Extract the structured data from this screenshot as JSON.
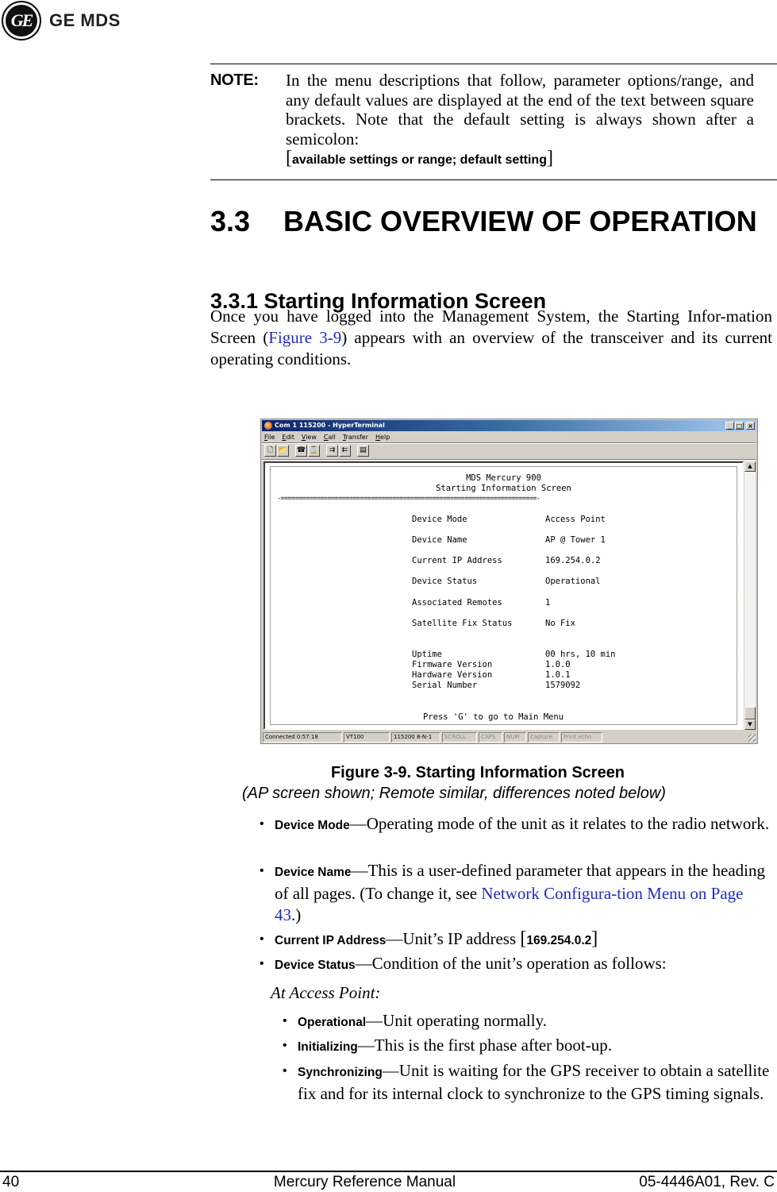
{
  "logo": {
    "monogram": "GE",
    "brand": "GE MDS"
  },
  "note": {
    "label": "NOTE:",
    "text": "In the menu descriptions that follow, parameter options/range, and any default values are displayed at the end of the text between square brackets. Note that the default setting is always shown after a semicolon:",
    "bracket_open": "[",
    "bracket_text": "available settings or range; default setting",
    "bracket_close": "]"
  },
  "section": {
    "number": "3.3",
    "title": "BASIC OVERVIEW OF OPERATION"
  },
  "subsection": {
    "title": "3.3.1 Starting Information Screen"
  },
  "intro": {
    "before": "Once you have logged into the Management System, the Starting Infor-mation Screen (",
    "link": "Figure 3-9",
    "after": ") appears with an overview of the transceiver and its current operating conditions."
  },
  "window": {
    "title": "Com 1 115200 - HyperTerminal",
    "controls": {
      "minimize": "_",
      "maximize": "□",
      "close": "×"
    },
    "menu": [
      "File",
      "Edit",
      "View",
      "Call",
      "Transfer",
      "Help"
    ],
    "toolbar": [
      {
        "name": "new-icon",
        "glyph": "🗋"
      },
      {
        "name": "open-icon",
        "glyph": "📂"
      },
      {
        "name": "connect-phone-icon",
        "glyph": "☎"
      },
      {
        "name": "disconnect-icon",
        "glyph": "⌛"
      },
      {
        "name": "send-icon",
        "glyph": "⇉"
      },
      {
        "name": "receive-icon",
        "glyph": "⇇"
      },
      {
        "name": "properties-icon",
        "glyph": "▤"
      }
    ],
    "terminal": {
      "header1": "MDS Mercury 900",
      "header2": "Starting Information Screen",
      "divider": "-=======================================================================-",
      "fields": [
        {
          "label": "Device Mode",
          "value": "Access Point"
        },
        {
          "label": "Device Name",
          "value": "AP @ Tower 1"
        },
        {
          "label": "Current IP Address",
          "value": "169.254.0.2"
        },
        {
          "label": "Device Status",
          "value": "Operational"
        },
        {
          "label": "Associated Remotes",
          "value": "1"
        },
        {
          "label": "Satellite Fix Status",
          "value": "No Fix"
        }
      ],
      "info": [
        {
          "label": "Uptime",
          "value": "00 hrs, 10 min"
        },
        {
          "label": "Firmware Version",
          "value": "1.0.0"
        },
        {
          "label": "Hardware Version",
          "value": "1.0.1"
        },
        {
          "label": "Serial Number",
          "value": "1579092"
        }
      ],
      "prompt": "Press 'G' to go to Main Menu"
    },
    "scroll": {
      "up": "▲",
      "down": "▼"
    },
    "status": {
      "connected": "Connected 0:57:18",
      "emulation": "VT100",
      "settings": "115200 8-N-1",
      "scroll": "SCROLL",
      "caps": "CAPS",
      "num": "NUM",
      "capture": "Capture",
      "print_echo": "Print echo"
    }
  },
  "figure": {
    "title": "Figure 3-9. Starting Information Screen",
    "subtitle": "(AP screen shown; Remote similar, differences noted below)"
  },
  "bullets": [
    {
      "term": "Device Mode",
      "text": "—Operating mode of the unit as it relates to the radio network."
    },
    {
      "term": "Device Name",
      "text": "—This is a user-defined parameter that appears in the heading of all pages. (To change it, see ",
      "link": "Network Configura-tion Menu on Page 43",
      "after": ".)"
    },
    {
      "term": "Current IP Address",
      "text": "—Unit’s IP address ",
      "bracket_open": "[",
      "value": "169.254.0.2",
      "bracket_close": "]"
    },
    {
      "term": "Device Status",
      "text": "—Condition of the unit’s operation as follows:"
    }
  ],
  "at_access_point": "At Access Point:",
  "status_bullets": [
    {
      "term": "Operational",
      "text": "—Unit operating normally."
    },
    {
      "term": "Initializing",
      "text": "—This is the first phase after boot-up."
    },
    {
      "term": "Synchronizing",
      "text": "—Unit is waiting for the GPS receiver to obtain a satellite fix and for its internal clock to synchronize to the GPS timing signals."
    }
  ],
  "bullet_glyph": "•",
  "footer": {
    "page": "40",
    "manual": "Mercury Reference Manual",
    "doc": "05-4446A01, Rev. C"
  }
}
